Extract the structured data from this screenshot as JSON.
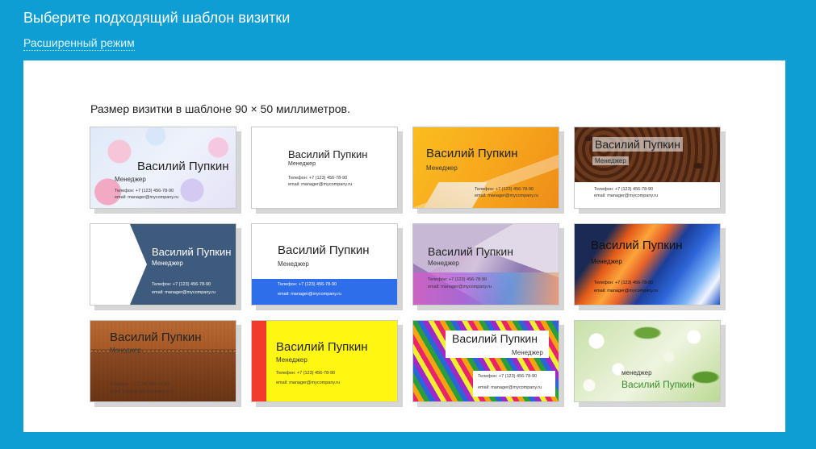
{
  "header": {
    "title": "Выберите подходящий шаблон визитки",
    "advanced_link": "Расширенный режим"
  },
  "panel": {
    "size_note": "Размер визитки в шаблоне 90 × 50 миллиметров."
  },
  "cards": [
    {
      "name": "Василий Пупкин",
      "role": "Менеджер",
      "phone": "Телефон: +7 (123) 456-78-90",
      "email": "email: manager@mycompany.ru"
    },
    {
      "name": "Василий Пупкин",
      "role": "Менеджер",
      "phone": "Телефон: +7 (123) 456-78-90",
      "email": "email: manager@mycompany.ru"
    },
    {
      "name": "Василий Пупкин",
      "role": "Менеджер",
      "phone": "Телефон: +7 (123) 456-78-90",
      "email": "email: manager@mycompany.ru"
    },
    {
      "name": "Василий Пупкин",
      "role": "Менеджер",
      "phone": "Телефон: +7 (123) 456-78-90",
      "email": "email: manager@mycompany.ru"
    },
    {
      "name": "Василий Пупкин",
      "role": "Менеджер",
      "phone": "Телефон: +7 (123) 456-78-90",
      "email": "email: manager@mycompany.ru"
    },
    {
      "name": "Василий Пупкин",
      "role": "Менеджер",
      "phone": "Телефон: +7 (123) 456-78-90",
      "email": "email: manager@mycompany.ru"
    },
    {
      "name": "Василий Пупкин",
      "role": "Менеджер",
      "phone": "Телефон: +7 (123) 456-78-90",
      "email": "email: manager@mycompany.ru"
    },
    {
      "name": "Василий Пупкин",
      "role": "Менеджер",
      "phone": "Телефон: +7 (123) 456-78-90",
      "email": "email: manager@mycompany.ru"
    },
    {
      "name": "Василий Пупкин",
      "role": "Менеджер",
      "phone": "Телефон: +7 (123) 456-78-90",
      "email": "email: manager@mycompany.ru"
    },
    {
      "name": "Василий Пупкин",
      "role": "Менеджер",
      "phone": "Телефон: +7 (123) 456-78-90",
      "email": "email: manager@mycompany.ru"
    },
    {
      "name": "Василий Пупкин",
      "role": "Менеджер",
      "phone": "Телефон: +7 (123) 456-78-90",
      "email": "email: manager@mycompany.ru"
    },
    {
      "name": "Василий Пупкин",
      "role": "менеджер"
    }
  ],
  "colors": {
    "background": "#0e9ed4",
    "panel": "#ffffff"
  }
}
